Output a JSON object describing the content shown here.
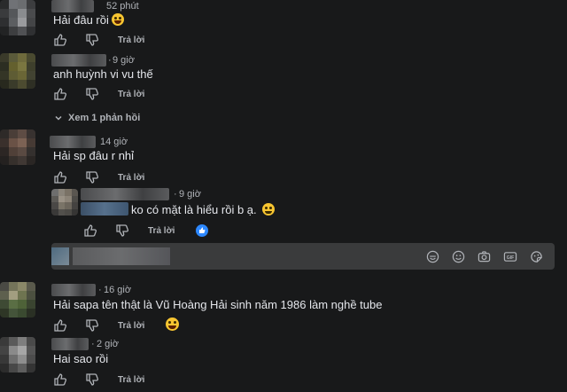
{
  "comments": [
    {
      "time": "52 phút",
      "text": "Hải đâu rồi",
      "emoji": "grin-face-icon",
      "reply_label": "Trả lời"
    },
    {
      "time": "9 giờ",
      "text": "anh huỳnh vi vu thế",
      "reply_label": "Trả lời",
      "view_replies": "Xem 1 phản hồi"
    },
    {
      "time": "14 giờ",
      "text": "Hải sp đâu r nhỉ",
      "reply_label": "Trả lời"
    },
    {
      "time": "9 giờ",
      "text": "ko có mặt là hiểu rồi b ạ.",
      "emoji": "smile-face-icon",
      "reply_label": "Trả lời",
      "reaction": "like-reaction-icon"
    },
    {
      "time": "16 giờ",
      "text": "Hải sapa tên thật là Vũ Hoàng Hải sinh năm 1986 làm nghề tube",
      "emoji": "grin-face-icon",
      "reply_label": "Trả lời"
    },
    {
      "time": "2 giờ",
      "text": "Hai sao rồi",
      "reply_label": "Trả lời"
    }
  ],
  "reply_input": {
    "tools": [
      "emoji-icon",
      "smiley-icon",
      "camera-icon",
      "gif-icon",
      "sticker-icon"
    ]
  },
  "colors": {
    "background": "#18191a",
    "text": "#e4e6eb",
    "muted": "#b0b3b8",
    "input_bg": "#3a3b3c",
    "like_blue": "#2d88ff"
  }
}
